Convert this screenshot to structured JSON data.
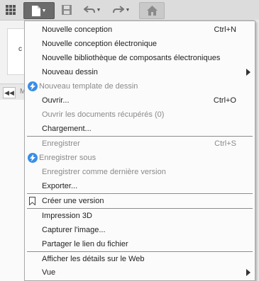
{
  "menu": {
    "items": [
      {
        "label": "Nouvelle conception",
        "shortcut": "Ctrl+N"
      },
      {
        "label": "Nouvelle conception électronique"
      },
      {
        "label": "Nouvelle bibliothèque de composants électroniques"
      },
      {
        "label": "Nouveau dessin",
        "submenu": true
      },
      {
        "label": "Nouveau template de dessin",
        "disabled": true,
        "icon": "upgrade-badge-icon"
      },
      {
        "label": "Ouvrir...",
        "shortcut": "Ctrl+O"
      },
      {
        "label": "Ouvrir les documents récupérés (0)",
        "disabled": true
      },
      {
        "label": "Chargement..."
      },
      {
        "label": "Enregistrer",
        "shortcut": "Ctrl+S",
        "disabled": true
      },
      {
        "label": "Enregistrer sous",
        "disabled": true,
        "icon": "upgrade-badge-icon"
      },
      {
        "label": "Enregistrer comme dernière version",
        "disabled": true
      },
      {
        "label": "Exporter..."
      },
      {
        "label": "Créer une version",
        "icon": "bookmark-icon"
      },
      {
        "label": "Impression 3D"
      },
      {
        "label": "Capturer l'image..."
      },
      {
        "label": "Partager le lien du fichier"
      },
      {
        "label": "Afficher les détails sur le Web"
      },
      {
        "label": "Vue",
        "submenu": true
      }
    ]
  },
  "background": {
    "panel_text": "c",
    "strip_text": "M"
  },
  "colors": {
    "badge": "#3a8ee6",
    "disabled_text": "#8a8a8a",
    "file_button": "#6b6b6b"
  }
}
